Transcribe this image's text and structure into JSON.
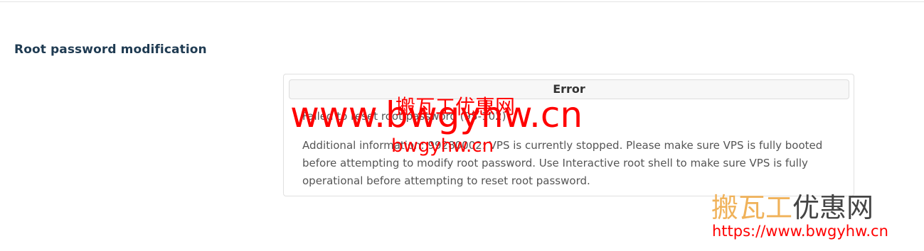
{
  "section": {
    "heading": "Root password modification"
  },
  "error_panel": {
    "title": "Error",
    "message": "Failed to reset root password (95-102)",
    "details": "Additional information: 99280002: VPS is currently stopped. Please make sure VPS is fully booted before attempting to modify root password. Use Interactive root shell to make sure VPS is fully operational before attempting to reset root password."
  },
  "watermark": {
    "cn_text": "搬瓦工优惠网",
    "domain_large": "www.bwgyhw.cn",
    "domain_small": "bwgyhw.cn"
  },
  "brand": {
    "cn_part1": "搬瓦工",
    "cn_part2": "优惠网",
    "url": "https://www.bwgyhw.cn"
  },
  "colors": {
    "heading": "#1f3b52",
    "watermark": "#ff0000",
    "brand_gold": "#f0b25a",
    "brand_dark": "#444444"
  }
}
